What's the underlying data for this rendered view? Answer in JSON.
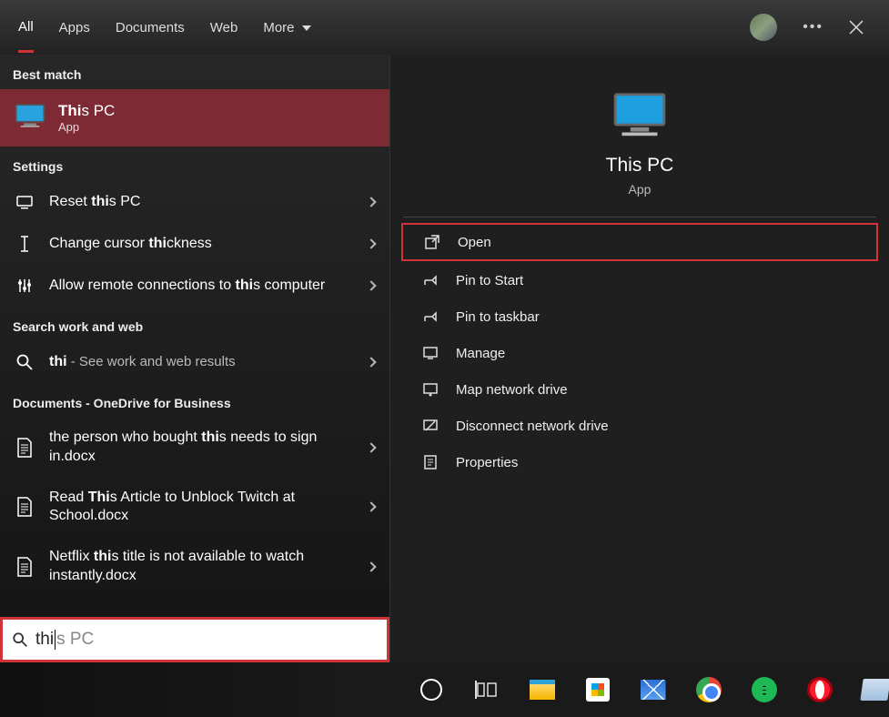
{
  "tabs": {
    "all": "All",
    "apps": "Apps",
    "documents": "Documents",
    "web": "Web",
    "more": "More"
  },
  "sections": {
    "best_match": "Best match",
    "settings": "Settings",
    "search_web": "Search work and web",
    "docs_header": "Documents - OneDrive for Business"
  },
  "best": {
    "title_prefix": "Thi",
    "title_rest": "s PC",
    "sub": "App"
  },
  "settings_items": [
    {
      "pre": "Reset ",
      "bold": "thi",
      "post": "s PC"
    },
    {
      "pre": "Change cursor ",
      "bold": "thi",
      "post": "ckness"
    },
    {
      "pre": "Allow remote connections to ",
      "bold": "thi",
      "post": "s computer"
    }
  ],
  "websearch": {
    "query": "thi",
    "suffix": " - See work and web results"
  },
  "docs": [
    {
      "pre": "the person who bought ",
      "bold": "thi",
      "post": "s needs to sign in.docx"
    },
    {
      "pre": "Read ",
      "bold": "Thi",
      "post": "s Article to Unblock Twitch at School.docx"
    },
    {
      "pre": "Netflix ",
      "bold": "thi",
      "post": "s title is not available to watch instantly.docx"
    }
  ],
  "preview": {
    "title": "This PC",
    "sub": "App"
  },
  "actions": {
    "open": "Open",
    "pin_start": "Pin to Start",
    "pin_taskbar": "Pin to taskbar",
    "manage": "Manage",
    "map": "Map network drive",
    "disconnect": "Disconnect network drive",
    "properties": "Properties"
  },
  "search": {
    "typed": "thi",
    "ghost": "s PC"
  }
}
